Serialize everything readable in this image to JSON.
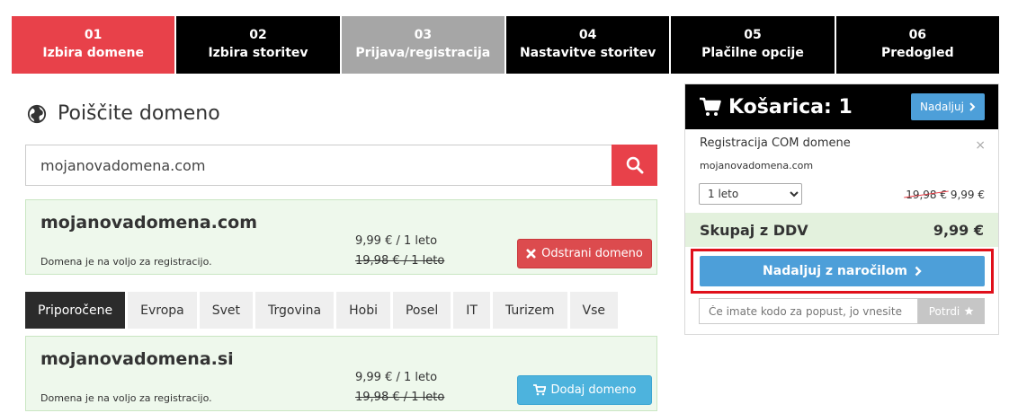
{
  "steps": [
    {
      "num": "01",
      "label": "Izbira domene",
      "state": "active"
    },
    {
      "num": "02",
      "label": "Izbira storitev",
      "state": "pending"
    },
    {
      "num": "03",
      "label": "Prijava/registracija",
      "state": "done"
    },
    {
      "num": "04",
      "label": "Nastavitve storitev",
      "state": "pending"
    },
    {
      "num": "05",
      "label": "Plačilne opcije",
      "state": "pending"
    },
    {
      "num": "06",
      "label": "Predogled",
      "state": "pending"
    }
  ],
  "search": {
    "heading": "Poiščite domeno",
    "value": "mojanovadomena.com"
  },
  "results": [
    {
      "domain": "mojanovadomena.com",
      "note": "Domena je na voljo za registracijo.",
      "price_now": "9,99 € / 1 leto",
      "price_old": "19,98 € / 1 leto",
      "action_label": "Odstrani domeno"
    },
    {
      "domain": "mojanovadomena.si",
      "note": "Domena je na voljo za registracijo.",
      "price_now": "9,99 € / 1 leto",
      "price_old": "19,98 € / 1 leto",
      "action_label": "Dodaj domeno"
    }
  ],
  "tabs": [
    "Priporočene",
    "Evropa",
    "Svet",
    "Trgovina",
    "Hobi",
    "Posel",
    "IT",
    "Turizem",
    "Vse"
  ],
  "cart": {
    "title": "Košarica: 1",
    "continue_label": "Nadaljuj",
    "item_title": "Registracija COM domene",
    "item_domain": "mojanovadomena.com",
    "period_selected": "1 leto",
    "close_symbol": "×",
    "price_old": "19,98 €",
    "price_new": "9,99 €",
    "total_label": "Skupaj z DDV",
    "total_value": "9,99 €",
    "checkout_label": "Nadaljuj z naročilom",
    "promo_placeholder": "Če imate kodo za popust, jo vnesite",
    "promo_button": "Potrdi"
  },
  "colors": {
    "accent_red": "#e8414a",
    "step_black": "#000000",
    "step_done": "#a6a6a6",
    "blue": "#4d9fd9",
    "success_bg": "#eef8ec"
  }
}
